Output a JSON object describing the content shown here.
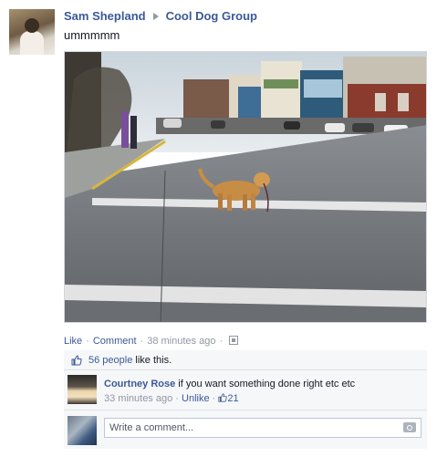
{
  "post": {
    "author": "Sam Shepland",
    "group": "Cool Dog Group",
    "status": "ummmmm"
  },
  "actions": {
    "like": "Like",
    "comment": "Comment",
    "time": "38 minutes ago",
    "separator": "·"
  },
  "likes": {
    "count_text": "56 people",
    "suffix": " like this."
  },
  "comments": [
    {
      "author": "Courtney Rose",
      "text": " if you want something done right etc etc",
      "time": "33 minutes ago",
      "unlike": "Unlike",
      "like_count": "21"
    }
  ],
  "composer": {
    "placeholder": "Write a comment..."
  },
  "colors": {
    "link": "#3b5998",
    "meta": "#9197a3",
    "ufi_background": "#f6f7f9"
  },
  "icons": [
    "breadcrumb-arrow-icon",
    "share-privacy-icon",
    "thumbs-up-icon",
    "camera-icon"
  ]
}
